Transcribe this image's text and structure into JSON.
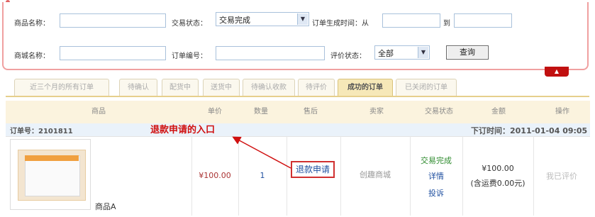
{
  "search": {
    "product_name_label": "商品名称：",
    "trade_status_label": "交易状态：",
    "trade_status_value": "交易完成",
    "order_time_label": "订单生成时间：从",
    "to_label": "到",
    "mall_name_label": "商城名称：",
    "order_no_label": "订单编号：",
    "review_status_label": "评价状态：",
    "review_status_value": "全部",
    "query_label": "查询",
    "collapse_icon": "▲"
  },
  "tabs": [
    {
      "label": "近三个月的所有订单"
    },
    {
      "label": "待确认"
    },
    {
      "label": "配货中"
    },
    {
      "label": "送货中"
    },
    {
      "label": "待确认收款"
    },
    {
      "label": "待评价"
    },
    {
      "label": "成功的订单",
      "active": true
    },
    {
      "label": "已关闭的订单"
    }
  ],
  "columns": [
    "商品",
    "单价",
    "数量",
    "售后",
    "卖家",
    "交易状态",
    "金额",
    "操作"
  ],
  "order": {
    "number": "订单号：2101811",
    "time": "下订时间：2011-01-04 09:05",
    "product_name": "商品A",
    "price": "¥100.00",
    "quantity": "1",
    "refund_link": "退款申请",
    "seller": "创趣商城",
    "status": "交易完成",
    "details_link": "详情",
    "complaint_link": "投诉",
    "amount": "¥100.00",
    "amount_note": "(含运费0.00元)",
    "action": "我已评价"
  },
  "annotation": {
    "text": "退款申请的入口"
  },
  "colors": {
    "annotation": "#d01010",
    "link": "#2050a0",
    "status_green": "#2e8b2e",
    "tab_active_bg": "#f6e8b8",
    "accent_red": "#c11010"
  }
}
